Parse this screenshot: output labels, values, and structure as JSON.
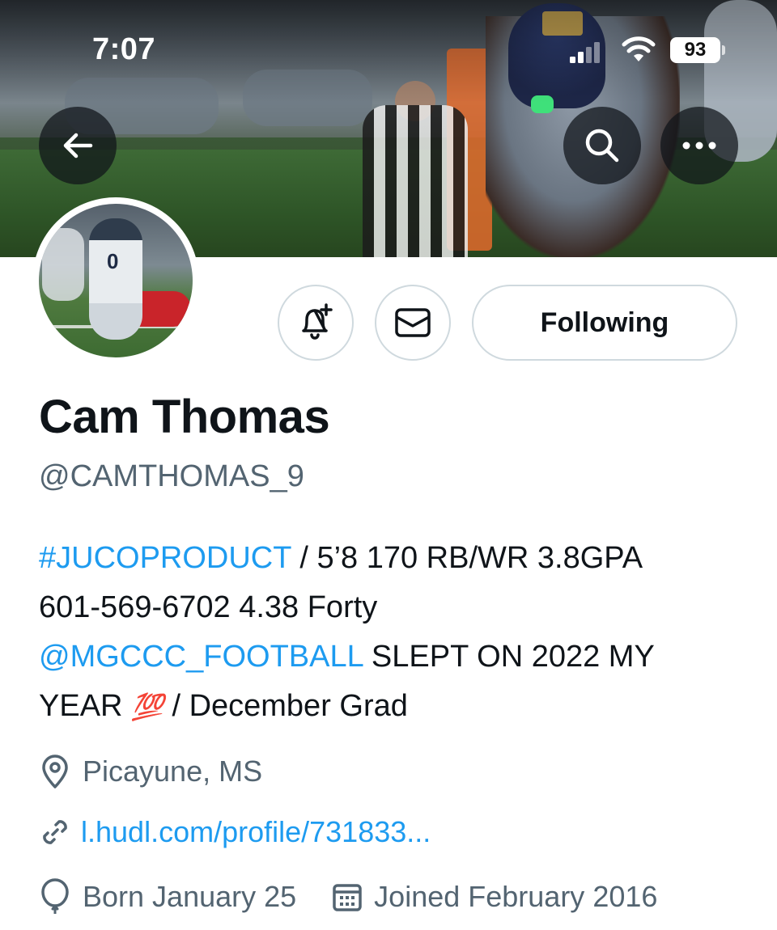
{
  "status_bar": {
    "time": "7:07",
    "battery": "93"
  },
  "header": {
    "back_icon": "arrow-left-icon",
    "search_icon": "search-icon",
    "more_icon": "more-horizontal-icon"
  },
  "actions": {
    "notify_icon": "bell-plus-icon",
    "message_icon": "envelope-icon",
    "following_label": "Following"
  },
  "profile": {
    "display_name": "Cam Thomas",
    "handle": "@CAMTHOMAS_9",
    "bio": {
      "line1_hashtag": "#JUCOPRODUCT",
      "line1_text": " / 5’8 170 RB/WR 3.8GPA",
      "line2_text": "601-569-6702 4.38 Forty",
      "line3_mention": "@MGCCC_FOOTBALL",
      "line3_text": " SLEPT ON 2022 MY",
      "line4_text": "YEAR ",
      "line4_emoji": "💯",
      "line4_text2": " / December Grad"
    },
    "location": "Picayune, MS",
    "website": "l.hudl.com/profile/731833...",
    "birthday": "Born January 25",
    "joined": "Joined February 2016"
  },
  "colors": {
    "link": "#1d9bf0",
    "secondary_text": "#536471",
    "border": "#cfd9de"
  }
}
